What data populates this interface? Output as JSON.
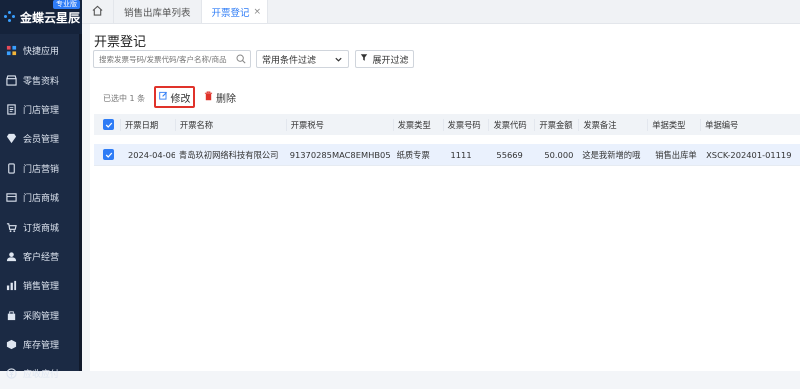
{
  "brand": {
    "name": "金蝶云星辰",
    "tag": "专业版"
  },
  "sidebar": {
    "items": [
      {
        "label": "快捷应用",
        "icon": "grid-icon"
      },
      {
        "label": "零售资料",
        "icon": "store-icon"
      },
      {
        "label": "门店管理",
        "icon": "document-icon"
      },
      {
        "label": "会员管理",
        "icon": "diamond-icon"
      },
      {
        "label": "门店营销",
        "icon": "phone-icon"
      },
      {
        "label": "门店商城",
        "icon": "window-icon"
      },
      {
        "label": "订货商城",
        "icon": "cart-icon"
      },
      {
        "label": "客户经营",
        "icon": "person-icon"
      },
      {
        "label": "销售管理",
        "icon": "chart-icon"
      },
      {
        "label": "采购管理",
        "icon": "bag-icon"
      },
      {
        "label": "库存管理",
        "icon": "box-icon"
      },
      {
        "label": "应收应付",
        "icon": "money-icon"
      }
    ]
  },
  "tabs": [
    {
      "label": "销售出库单列表",
      "active": false
    },
    {
      "label": "开票登记",
      "active": true
    }
  ],
  "page": {
    "title": "开票登记",
    "search_placeholder": "搜索发票号码/发票代码/客户名称/商品",
    "filter_select": "常用条件过滤",
    "expand_filter": "展开过滤",
    "selected_count": "已选中 1 条",
    "edit_label": "修改",
    "delete_label": "删除"
  },
  "table": {
    "columns": [
      "开票日期",
      "开票名称",
      "开票税号",
      "发票类型",
      "发票号码",
      "发票代码",
      "开票金额",
      "发票备注",
      "单据类型",
      "单据编号"
    ],
    "rows": [
      [
        "2024-04-06",
        "青岛玖初网络科技有限公司",
        "91370285MAC8EMHB05",
        "纸质专票",
        "1111",
        "55669",
        "50.000",
        "这是我新增的哦",
        "销售出库单",
        "XSCK-202401-01119"
      ]
    ]
  },
  "colors": {
    "accent": "#2e7cf6",
    "sidebar": "#1b2a44",
    "danger": "#e0322a"
  }
}
